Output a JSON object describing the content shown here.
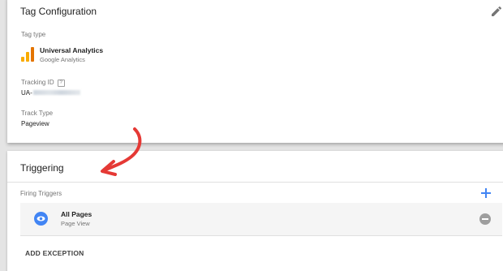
{
  "tag_configuration": {
    "title": "Tag Configuration",
    "tag_type_label": "Tag type",
    "tag_name": "Universal Analytics",
    "tag_vendor": "Google Analytics",
    "tracking_id_label": "Tracking ID",
    "tracking_id_help": "?",
    "tracking_id_prefix": "UA-",
    "track_type_label": "Track Type",
    "track_type_value": "Pageview"
  },
  "triggering": {
    "title": "Triggering",
    "firing_triggers_label": "Firing Triggers",
    "triggers": [
      {
        "name": "All Pages",
        "type": "Page View"
      }
    ],
    "add_exception_label": "ADD EXCEPTION"
  },
  "icons": {
    "edit": "pencil-icon",
    "add": "plus-icon",
    "trigger": "eye-icon",
    "remove": "minus-circle-icon",
    "tag_logo": "google-analytics-logo"
  },
  "colors": {
    "accent_blue": "#4285f4",
    "annotation_red": "#e53935",
    "ga_orange": "#f9ab00",
    "ga_orange_dark": "#e37400"
  }
}
